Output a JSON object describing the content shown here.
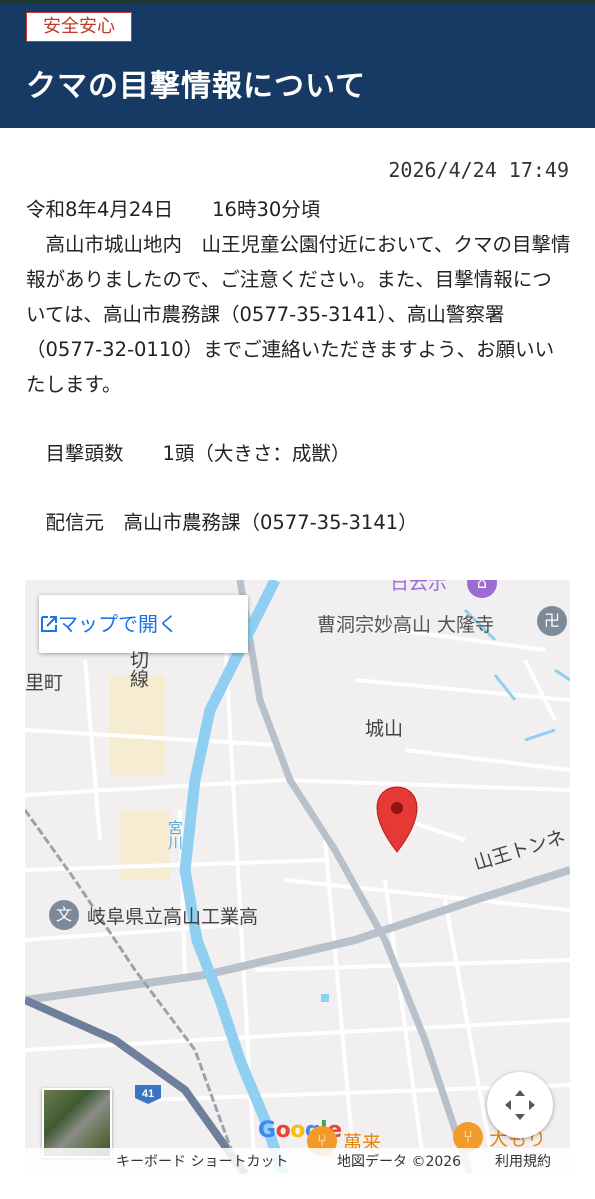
{
  "header": {
    "category_badge": "安全安心",
    "title": "クマの目撃情報について"
  },
  "article": {
    "timestamp": "2026/4/24 17:49",
    "lines": [
      "令和8年4月24日　　16時30分頃",
      "　高山市城山地内　山王児童公園付近において、クマの目撃情報がありましたので、ご注意ください。また、目撃情報については、高山市農務課（0577-35-3141）、高山警察署（0577-32-0110）までご連絡いただきますよう、お願いいたします。",
      "　目撃頭数　　1頭（大きさ：成獣）",
      "　配信元　高山市農務課（0577-35-3141）"
    ]
  },
  "map": {
    "open_in_maps_label": "マップで開く",
    "labels": {
      "temple": "曹洞宗妙高山 大隆寺",
      "shiroyama": "城山",
      "satomachi": "里町",
      "kiri_line": "切線",
      "miya_river": "宮川",
      "school": "岐阜県立高山工業高",
      "tunnel": "山王トンネ",
      "top_cut": "日云示",
      "route_number": "41",
      "restaurant_1": "萬来",
      "restaurant_2": "大もり"
    },
    "poi_icons": {
      "temple": "manji-icon",
      "school": "school-icon",
      "restaurant": "fork-knife-icon"
    },
    "attribution": {
      "keyboard_shortcuts": "キーボード ショートカット",
      "map_data": "地図データ ©2026",
      "terms": "利用規約"
    },
    "google_logo": "Google",
    "colors": {
      "header_bg": "#163a63",
      "badge_red": "#c0392b",
      "link_blue": "#1a73e8",
      "river": "#8fd0f2",
      "marker_red": "#e53935",
      "poi_gray": "#7d8b99",
      "poi_orange": "#f29b2b",
      "poi_purple": "#9c6bd3"
    }
  }
}
